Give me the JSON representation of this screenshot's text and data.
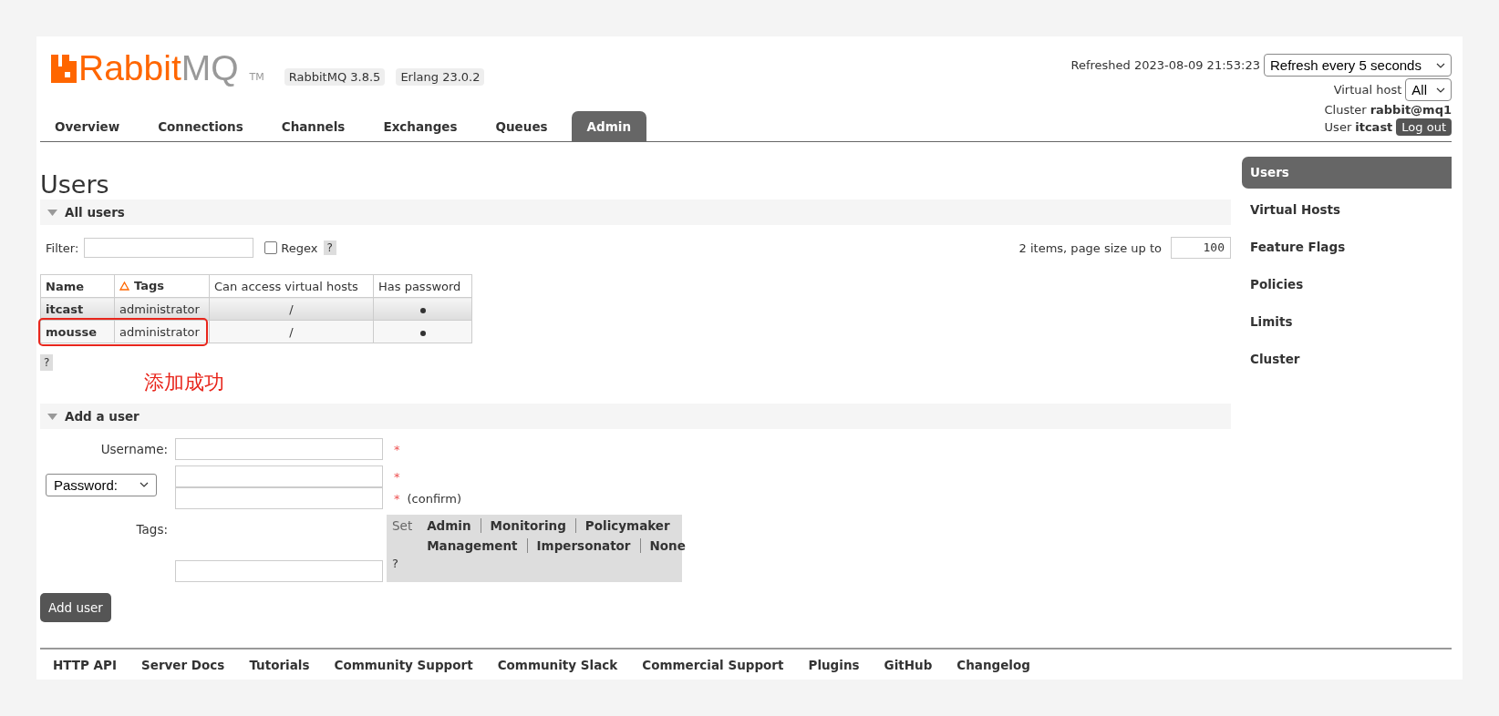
{
  "logo": {
    "brand": "Rabbit",
    "brand_suffix": "MQ",
    "trademark": "TM"
  },
  "versions": [
    "RabbitMQ 3.8.5",
    "Erlang 23.0.2"
  ],
  "tabs": [
    {
      "label": "Overview",
      "selected": false
    },
    {
      "label": "Connections",
      "selected": false
    },
    {
      "label": "Channels",
      "selected": false
    },
    {
      "label": "Exchanges",
      "selected": false
    },
    {
      "label": "Queues",
      "selected": false
    },
    {
      "label": "Admin",
      "selected": true
    }
  ],
  "status": {
    "refreshed": "Refreshed 2023-08-09 21:53:23",
    "refresh_select": "Refresh every 5 seconds",
    "vhost_label": "Virtual host",
    "vhost_select": "All",
    "cluster_label": "Cluster",
    "cluster": "rabbit@mq1",
    "user_label": "User",
    "user": "itcast",
    "logout": "Log out"
  },
  "page_title": "Users",
  "all_users": {
    "title": "All users",
    "expanded": true
  },
  "filter": {
    "label": "Filter:",
    "regex_label": "Regex",
    "regex_checked": false,
    "help": "?"
  },
  "paging": {
    "summary": "2 items, page size up to",
    "page_size": "100"
  },
  "table": {
    "columns": [
      {
        "label": "Name",
        "sorted": false
      },
      {
        "label": "Tags",
        "sorted": true
      },
      {
        "label": "Can access virtual hosts",
        "sorted": false
      },
      {
        "label": "Has password",
        "sorted": false
      }
    ],
    "rows": [
      {
        "name": "itcast",
        "tags": "administrator",
        "vhosts": "/",
        "has_password": true,
        "highlighted": false
      },
      {
        "name": "mousse",
        "tags": "administrator",
        "vhosts": "/",
        "has_password": true,
        "highlighted": true
      }
    ]
  },
  "table_help": "?",
  "annotation": {
    "text": "添加成功"
  },
  "add_user": {
    "title": "Add a user",
    "expanded": true,
    "username_label": "Username:",
    "password_select": "Password:",
    "required_marks": [
      "*",
      "*",
      "*"
    ],
    "confirm_note": "(confirm)",
    "tags_label": "Tags:",
    "tag_set_label": "Set",
    "tag_options": [
      [
        "Admin",
        "Monitoring",
        "Policymaker"
      ],
      [
        "Management",
        "Impersonator",
        "None"
      ]
    ],
    "tags_help": "?",
    "submit": "Add user"
  },
  "sidebar": {
    "items": [
      {
        "label": "Users",
        "selected": true
      },
      {
        "label": "Virtual Hosts",
        "selected": false
      },
      {
        "label": "Feature Flags",
        "selected": false
      },
      {
        "label": "Policies",
        "selected": false
      },
      {
        "label": "Limits",
        "selected": false
      },
      {
        "label": "Cluster",
        "selected": false
      }
    ]
  },
  "footer": {
    "links": [
      "HTTP API",
      "Server Docs",
      "Tutorials",
      "Community Support",
      "Community Slack",
      "Commercial Support",
      "Plugins",
      "GitHub",
      "Changelog"
    ]
  }
}
